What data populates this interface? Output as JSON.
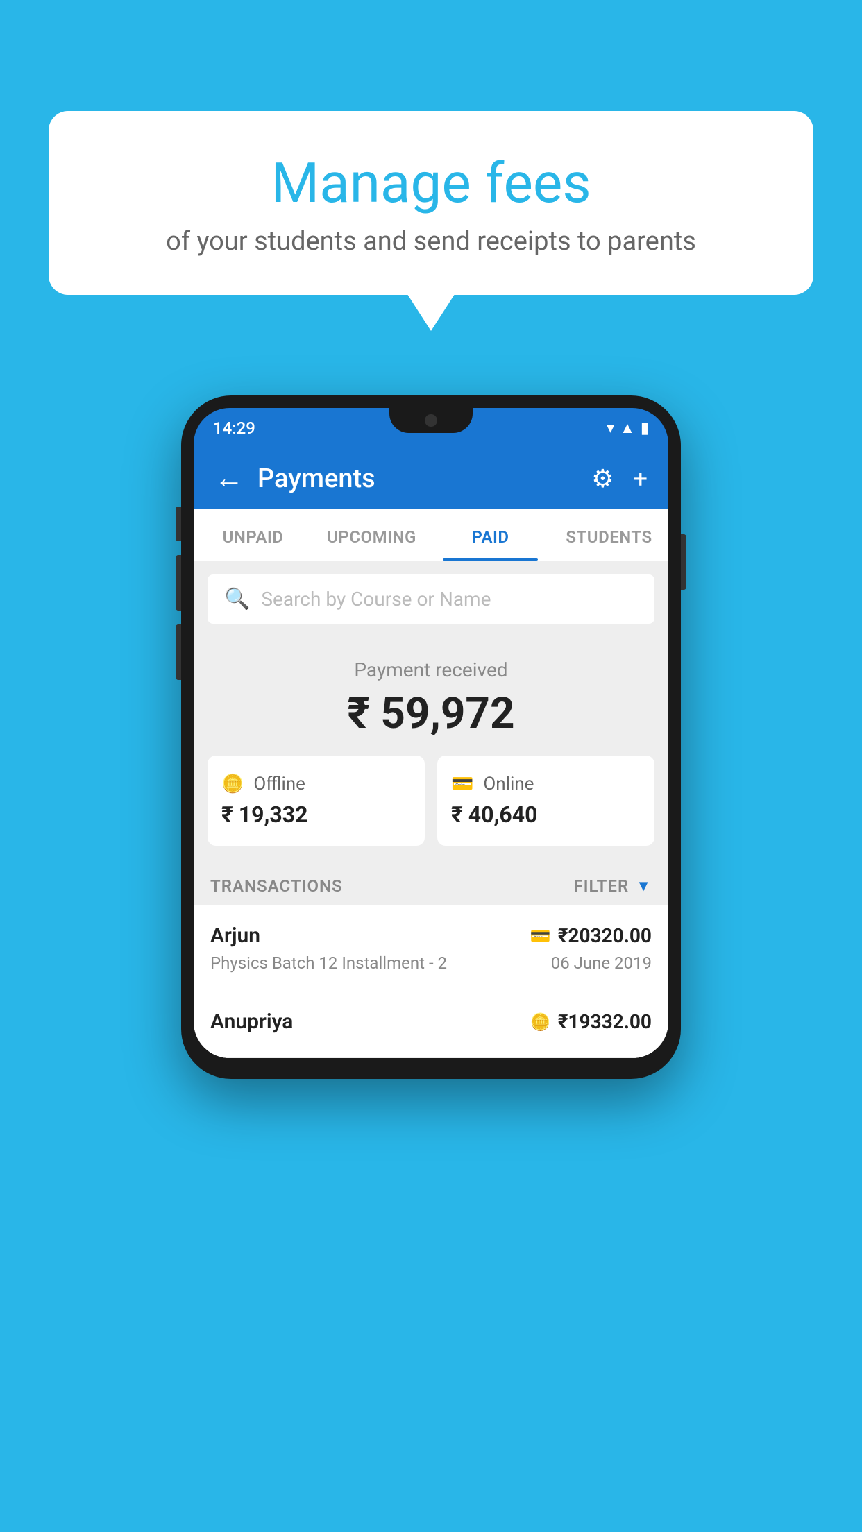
{
  "background_color": "#29b6e8",
  "bubble": {
    "title": "Manage fees",
    "subtitle": "of your students and send receipts to parents"
  },
  "phone": {
    "status_bar": {
      "time": "14:29",
      "icons": [
        "▲",
        "▲",
        "▮"
      ]
    },
    "app_bar": {
      "title": "Payments",
      "back_label": "←",
      "settings_icon": "⚙",
      "add_icon": "+"
    },
    "tabs": [
      {
        "label": "UNPAID",
        "active": false
      },
      {
        "label": "UPCOMING",
        "active": false
      },
      {
        "label": "PAID",
        "active": true
      },
      {
        "label": "STUDENTS",
        "active": false
      }
    ],
    "search": {
      "placeholder": "Search by Course or Name"
    },
    "payment_summary": {
      "label": "Payment received",
      "total": "₹ 59,972",
      "offline": {
        "type": "Offline",
        "amount": "₹ 19,332"
      },
      "online": {
        "type": "Online",
        "amount": "₹ 40,640"
      }
    },
    "transactions": {
      "header_label": "TRANSACTIONS",
      "filter_label": "FILTER",
      "items": [
        {
          "name": "Arjun",
          "course": "Physics Batch 12 Installment - 2",
          "amount": "₹20320.00",
          "date": "06 June 2019",
          "payment_mode": "card"
        },
        {
          "name": "Anupriya",
          "course": "",
          "amount": "₹19332.00",
          "date": "",
          "payment_mode": "offline"
        }
      ]
    }
  }
}
